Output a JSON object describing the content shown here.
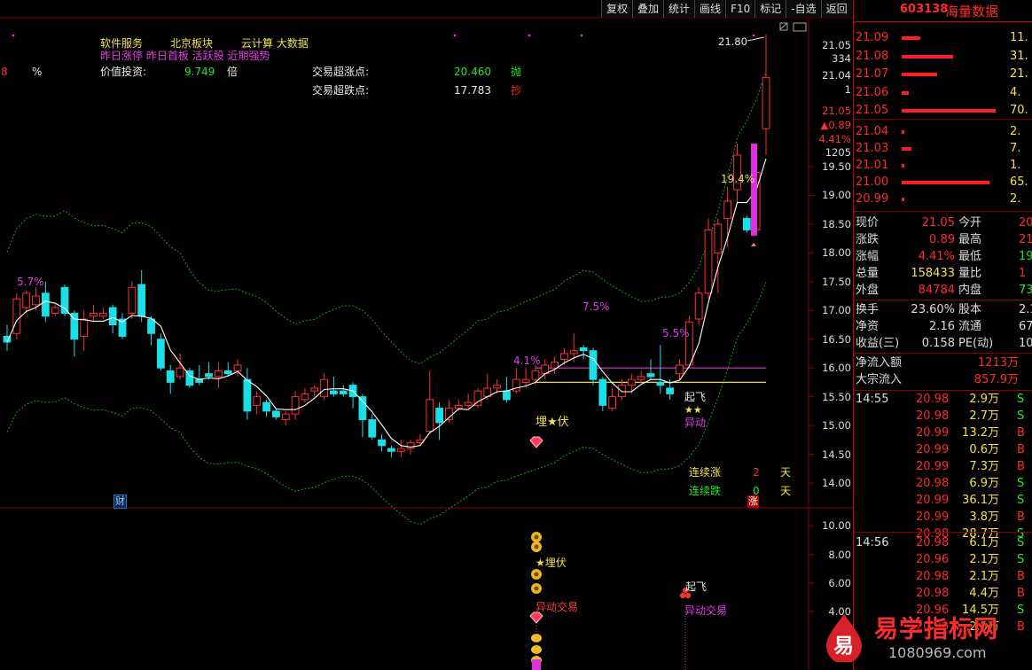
{
  "toolbar": [
    "复权",
    "叠加",
    "统计",
    "画线",
    "F10",
    "标记",
    "-自选",
    "返回"
  ],
  "stock": {
    "code": "603138",
    "name": "海量数据"
  },
  "header": {
    "line1": [
      "软件服务",
      "北京板块",
      "云计算 大数据"
    ],
    "line2": "昨日涨停 昨日首板 活跃股 近期强势",
    "left_num": "8",
    "pct": "%",
    "value_label": "价值投资:",
    "value_num": "9.749",
    "value_unit": "倍",
    "sell_label": "交易超涨点:",
    "sell_value": "20.460",
    "sell_tag": "抛",
    "buy_label": "交易超跌点:",
    "buy_value": "17.783",
    "buy_tag": "抄"
  },
  "annotations": {
    "high_price": "21.80",
    "pct_57": "5.7%",
    "pct_41": "4.1%",
    "pct_75": "7.5%",
    "pct_55": "5.5%",
    "pct_194": "19.4%",
    "maifu": "埋★伏",
    "qifei": "起飞",
    "stars": "★★",
    "yidong": "异动",
    "lianxu_zhang": "连续涨",
    "lianxu_zhang_n": "2",
    "lianxu_die": "连续跌",
    "lianxu_die_n": "0",
    "tian": "天",
    "cai": "财",
    "zhang": "涨",
    "sub_maifu": "★埋伏",
    "sub_yidong1": "异动交易",
    "sub_qifei": "起飞",
    "sub_yidong2": "异动交易"
  },
  "price_axis": {
    "top_ticks": [
      "21.05",
      "334",
      "21.04",
      "1"
    ],
    "mid_ticks": [
      "21.05",
      "▲0.89",
      "4.41%",
      "1205"
    ],
    "ticks": [
      "19.50",
      "19.00",
      "18.50",
      "18.00",
      "17.50",
      "17.00",
      "16.50",
      "16.00",
      "15.50",
      "15.00",
      "14.50",
      "14.00"
    ],
    "sub_ticks": [
      "10.00",
      "8.00",
      "6.00",
      "4.00"
    ]
  },
  "order_book": {
    "sell": [
      {
        "price": "21.09",
        "vol": "11.",
        "bar": 0.2
      },
      {
        "price": "21.08",
        "vol": "31.",
        "bar": 0.55
      },
      {
        "price": "21.07",
        "vol": "21.",
        "bar": 0.38
      },
      {
        "price": "21.06",
        "vol": "4.",
        "bar": 0.08
      },
      {
        "price": "21.05",
        "vol": "70.",
        "bar": 1.0
      }
    ],
    "buy": [
      {
        "price": "21.04",
        "vol": "2.",
        "bar": 0.03
      },
      {
        "price": "21.03",
        "vol": "7.",
        "bar": 0.1
      },
      {
        "price": "21.01",
        "vol": "1.",
        "bar": 0.02
      },
      {
        "price": "21.00",
        "vol": "65.",
        "bar": 0.93
      },
      {
        "price": "20.99",
        "vol": "2.",
        "bar": 0.03
      }
    ]
  },
  "quote": [
    {
      "k1": "现价",
      "v1": "21.05",
      "k2": "今开",
      "v2": "20"
    },
    {
      "k1": "涨跌",
      "v1": "0.89",
      "k2": "最高",
      "v2": "21"
    },
    {
      "k1": "涨幅",
      "v1": "4.41%",
      "k2": "最低",
      "v2": "19"
    },
    {
      "k1": "总量",
      "v1": "158433",
      "k2": "量比",
      "v2": "1"
    },
    {
      "k1": "外盘",
      "v1": "84784",
      "k2": "内盘",
      "v2": "73"
    }
  ],
  "quote2": [
    {
      "k1": "换手",
      "v1": "23.60%",
      "k2": "股本",
      "v2": "2.1"
    },
    {
      "k1": "净资",
      "v1": "2.16",
      "k2": "流通",
      "v2": "671"
    },
    {
      "k1": "收益(三)",
      "v1": "0.158",
      "k2": "PE(动)",
      "v2": "10"
    }
  ],
  "flows": [
    {
      "label": "净流入额",
      "value": "1213万"
    },
    {
      "label": "大宗流入",
      "value": "857.9万"
    }
  ],
  "ticks_1455": {
    "time": "14:55",
    "rows": [
      [
        "20.98",
        "2.9万",
        "S"
      ],
      [
        "20.98",
        "2.7万",
        "S"
      ],
      [
        "20.99",
        "13.2万",
        "B"
      ],
      [
        "20.99",
        "0.6万",
        "B"
      ],
      [
        "20.99",
        "7.3万",
        "B"
      ],
      [
        "20.98",
        "6.9万",
        "S"
      ],
      [
        "20.99",
        "36.1万",
        "S"
      ],
      [
        "20.99",
        "3.8万",
        "B"
      ],
      [
        "20.98",
        "28.7万",
        "S"
      ]
    ]
  },
  "ticks_1456": {
    "time": "14:56",
    "rows": [
      [
        "20.98",
        "6.1万",
        "S"
      ],
      [
        "20.96",
        "2.1万",
        "S"
      ],
      [
        "20.98",
        "2.1万",
        "B"
      ],
      [
        "20.98",
        "4.4万",
        "B"
      ],
      [
        "20.96",
        "14.5万",
        "S"
      ],
      [
        "20.99",
        "2.5万",
        "B"
      ]
    ]
  },
  "watermark": {
    "badge": "易",
    "text": "易学指标网",
    "url": "1080969.com"
  },
  "chart_data": {
    "type": "candlestick",
    "ylim": [
      13.6,
      21.9
    ],
    "candles": [
      {
        "o": 16.55,
        "h": 16.75,
        "c": 16.45,
        "l": 16.3
      },
      {
        "o": 16.6,
        "h": 17.3,
        "c": 17.2,
        "l": 16.5
      },
      {
        "o": 17.05,
        "h": 17.35,
        "c": 17.3,
        "l": 16.95
      },
      {
        "o": 17.1,
        "h": 17.4,
        "c": 17.25,
        "l": 17.0
      },
      {
        "o": 17.3,
        "h": 17.5,
        "c": 16.9,
        "l": 16.8
      },
      {
        "o": 16.95,
        "h": 17.1,
        "c": 17.05,
        "l": 16.9
      },
      {
        "o": 17.4,
        "h": 17.45,
        "c": 16.95,
        "l": 16.9
      },
      {
        "o": 16.95,
        "h": 17.0,
        "c": 16.5,
        "l": 16.2
      },
      {
        "o": 16.55,
        "h": 17.0,
        "c": 16.85,
        "l": 16.3
      },
      {
        "o": 16.9,
        "h": 17.1,
        "c": 16.95,
        "l": 16.8
      },
      {
        "o": 16.9,
        "h": 17.05,
        "c": 16.95,
        "l": 16.85
      },
      {
        "o": 17.05,
        "h": 17.1,
        "c": 16.75,
        "l": 16.6
      },
      {
        "o": 16.85,
        "h": 16.95,
        "c": 16.55,
        "l": 16.5
      },
      {
        "o": 16.95,
        "h": 17.5,
        "c": 17.4,
        "l": 16.85
      },
      {
        "o": 17.45,
        "h": 17.7,
        "c": 16.9,
        "l": 16.8
      },
      {
        "o": 16.85,
        "h": 16.9,
        "c": 16.6,
        "l": 16.4
      },
      {
        "o": 16.5,
        "h": 16.6,
        "c": 16.0,
        "l": 15.95
      },
      {
        "o": 15.95,
        "h": 16.05,
        "c": 15.75,
        "l": 15.55
      },
      {
        "o": 15.85,
        "h": 16.25,
        "c": 16.0,
        "l": 15.8
      },
      {
        "o": 15.95,
        "h": 16.0,
        "c": 15.7,
        "l": 15.65
      },
      {
        "o": 15.8,
        "h": 16.05,
        "c": 15.75,
        "l": 15.7
      },
      {
        "o": 15.9,
        "h": 16.1,
        "c": 15.85,
        "l": 15.8
      },
      {
        "o": 15.85,
        "h": 16.1,
        "c": 15.95,
        "l": 15.65
      },
      {
        "o": 15.95,
        "h": 16.1,
        "c": 15.9,
        "l": 15.85
      },
      {
        "o": 15.95,
        "h": 16.15,
        "c": 16.05,
        "l": 15.85
      },
      {
        "o": 15.8,
        "h": 16.0,
        "c": 15.25,
        "l": 15.1
      },
      {
        "o": 15.35,
        "h": 15.6,
        "c": 15.5,
        "l": 15.2
      },
      {
        "o": 15.4,
        "h": 15.45,
        "c": 15.25,
        "l": 15.15
      },
      {
        "o": 15.25,
        "h": 15.3,
        "c": 15.15,
        "l": 15.1
      },
      {
        "o": 15.1,
        "h": 15.25,
        "c": 15.2,
        "l": 15.0
      },
      {
        "o": 15.2,
        "h": 15.6,
        "c": 15.5,
        "l": 15.1
      },
      {
        "o": 15.45,
        "h": 15.65,
        "c": 15.55,
        "l": 15.4
      },
      {
        "o": 15.6,
        "h": 15.7,
        "c": 15.65,
        "l": 15.5
      },
      {
        "o": 15.5,
        "h": 15.9,
        "c": 15.8,
        "l": 15.45
      },
      {
        "o": 15.6,
        "h": 15.85,
        "c": 15.55,
        "l": 15.5
      },
      {
        "o": 15.6,
        "h": 15.7,
        "c": 15.55,
        "l": 15.5
      },
      {
        "o": 15.7,
        "h": 15.75,
        "c": 15.5,
        "l": 15.3
      },
      {
        "o": 15.5,
        "h": 15.55,
        "c": 15.1,
        "l": 14.8
      },
      {
        "o": 15.1,
        "h": 15.2,
        "c": 14.8,
        "l": 14.75
      },
      {
        "o": 14.75,
        "h": 14.85,
        "c": 14.65,
        "l": 14.55
      },
      {
        "o": 14.6,
        "h": 14.65,
        "c": 14.55,
        "l": 14.45
      },
      {
        "o": 14.55,
        "h": 14.75,
        "c": 14.6,
        "l": 14.45
      },
      {
        "o": 14.6,
        "h": 14.75,
        "c": 14.7,
        "l": 14.5
      },
      {
        "o": 14.7,
        "h": 14.85,
        "c": 14.75,
        "l": 14.65
      },
      {
        "o": 14.9,
        "h": 15.95,
        "c": 15.45,
        "l": 14.85
      },
      {
        "o": 15.3,
        "h": 15.4,
        "c": 15.05,
        "l": 14.75
      },
      {
        "o": 15.1,
        "h": 15.45,
        "c": 15.3,
        "l": 15.05
      },
      {
        "o": 15.3,
        "h": 15.45,
        "c": 15.35,
        "l": 15.25
      },
      {
        "o": 15.35,
        "h": 15.55,
        "c": 15.4,
        "l": 15.3
      },
      {
        "o": 15.35,
        "h": 15.65,
        "c": 15.6,
        "l": 15.3
      },
      {
        "o": 15.5,
        "h": 15.9,
        "c": 15.65,
        "l": 15.45
      },
      {
        "o": 15.65,
        "h": 15.8,
        "c": 15.7,
        "l": 15.55
      },
      {
        "o": 15.6,
        "h": 15.85,
        "c": 15.45,
        "l": 15.4
      },
      {
        "o": 15.6,
        "h": 16.0,
        "c": 15.8,
        "l": 15.55
      },
      {
        "o": 15.75,
        "h": 16.0,
        "c": 15.8,
        "l": 15.65
      },
      {
        "o": 15.8,
        "h": 16.05,
        "c": 15.95,
        "l": 15.7
      },
      {
        "o": 15.9,
        "h": 16.15,
        "c": 16.05,
        "l": 15.8
      },
      {
        "o": 16.0,
        "h": 16.2,
        "c": 16.1,
        "l": 15.9
      },
      {
        "o": 16.15,
        "h": 16.35,
        "c": 16.25,
        "l": 16.05
      },
      {
        "o": 16.25,
        "h": 16.6,
        "c": 16.3,
        "l": 16.1
      },
      {
        "o": 16.35,
        "h": 16.4,
        "c": 16.3,
        "l": 16.15
      },
      {
        "o": 16.3,
        "h": 16.35,
        "c": 15.8,
        "l": 15.7
      },
      {
        "o": 15.8,
        "h": 15.85,
        "c": 15.35,
        "l": 15.25
      },
      {
        "o": 15.3,
        "h": 15.65,
        "c": 15.5,
        "l": 15.25
      },
      {
        "o": 15.5,
        "h": 15.8,
        "c": 15.7,
        "l": 15.45
      },
      {
        "o": 15.7,
        "h": 15.9,
        "c": 15.8,
        "l": 15.55
      },
      {
        "o": 15.8,
        "h": 15.95,
        "c": 15.85,
        "l": 15.7
      },
      {
        "o": 15.9,
        "h": 16.15,
        "c": 15.85,
        "l": 15.8
      },
      {
        "o": 15.75,
        "h": 16.4,
        "c": 15.7,
        "l": 15.55
      },
      {
        "o": 15.65,
        "h": 15.8,
        "c": 15.55,
        "l": 15.45
      },
      {
        "o": 15.9,
        "h": 16.15,
        "c": 16.05,
        "l": 15.8
      },
      {
        "o": 16.05,
        "h": 16.9,
        "c": 16.8,
        "l": 16.0
      },
      {
        "o": 16.85,
        "h": 17.4,
        "c": 17.3,
        "l": 16.75
      },
      {
        "o": 17.3,
        "h": 18.6,
        "c": 18.4,
        "l": 17.2
      },
      {
        "o": 18.0,
        "h": 18.6,
        "c": 18.5,
        "l": 17.3
      },
      {
        "o": 18.6,
        "h": 19.15,
        "c": 18.9,
        "l": 18.1
      },
      {
        "o": 19.1,
        "h": 19.9,
        "c": 19.7,
        "l": 18.85
      },
      {
        "o": 18.6,
        "h": 18.65,
        "c": 18.4,
        "l": 18.35
      },
      {
        "o": 18.4,
        "h": 19.5,
        "c": 19.4,
        "l": 18.3
      },
      {
        "o": 20.16,
        "h": 21.8,
        "c": 21.05,
        "l": 19.7
      }
    ],
    "magenta_bar": {
      "top": 19.9,
      "bottom": 18.3
    },
    "support_lines": [
      16.0,
      15.75
    ]
  }
}
